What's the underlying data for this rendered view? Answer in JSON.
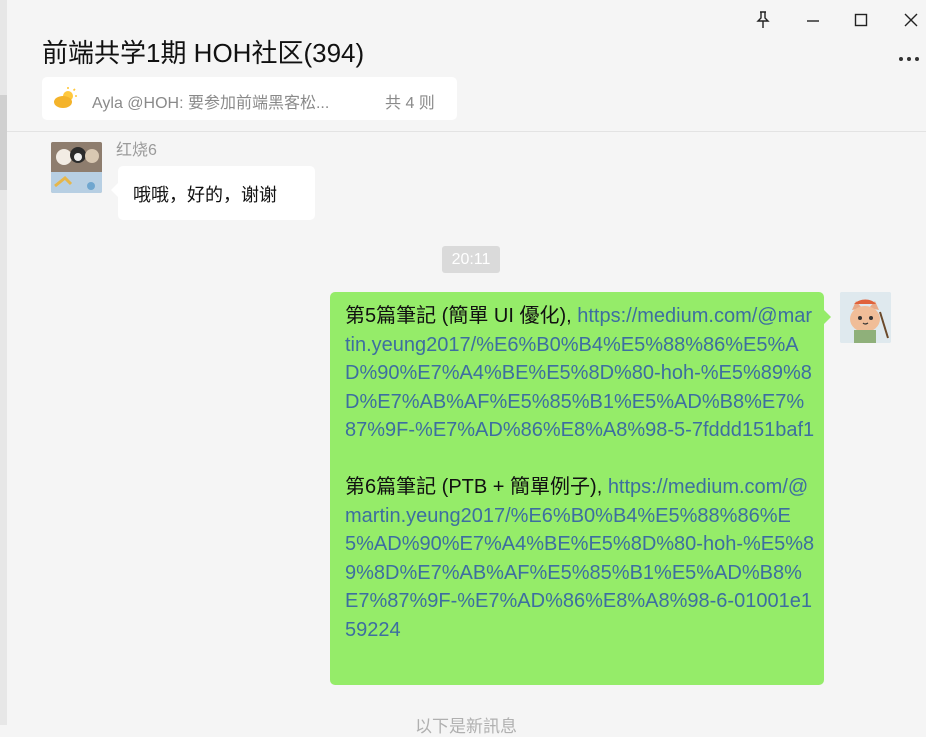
{
  "window": {
    "title": "前端共学1期 HOH社区(394)",
    "controls": {
      "pin_icon": "pin-icon",
      "minimize_icon": "minimize-icon",
      "maximize_icon": "maximize-icon",
      "close_icon": "close-icon",
      "more_icon": "more-icon"
    }
  },
  "notice": {
    "icon": "sun-icon",
    "text": "Ayla @HOH: 要参加前端黑客松...",
    "count": "共 4 则"
  },
  "messages": {
    "incoming": {
      "sender": "红烧6",
      "text": "哦哦，好的，谢谢"
    },
    "timestamp": "20:11",
    "outgoing": {
      "part1_text": "第5篇筆記 (簡單 UI 優化), ",
      "part1_link": "https://medium.com/@martin.yeung2017/%E6%B0%B4%E5%88%86%E5%AD%90%E7%A4%BE%E5%8D%80-hoh-%E5%89%8D%E7%AB%AF%E5%85%B1%E5%AD%B8%E7%87%9F-%E7%AD%86%E8%A8%98-5-7fddd151baf1",
      "part2_text": "第6篇筆記 (PTB + 簡單例子), ",
      "part2_link": "https://medium.com/@martin.yeung2017/%E6%B0%B4%E5%88%86%E5%AD%90%E7%A4%BE%E5%8D%80-hoh-%E5%89%8D%E7%AB%AF%E5%85%B1%E5%AD%B8%E7%87%9F-%E7%AD%86%E8%A8%98-6-01001e159224"
    }
  },
  "bottom_hint": "以下是新訊息",
  "colors": {
    "background": "#f5f5f5",
    "outgoing_bubble": "#95ec69",
    "link": "#3d6ea0",
    "timestamp_bg": "#dadada"
  }
}
